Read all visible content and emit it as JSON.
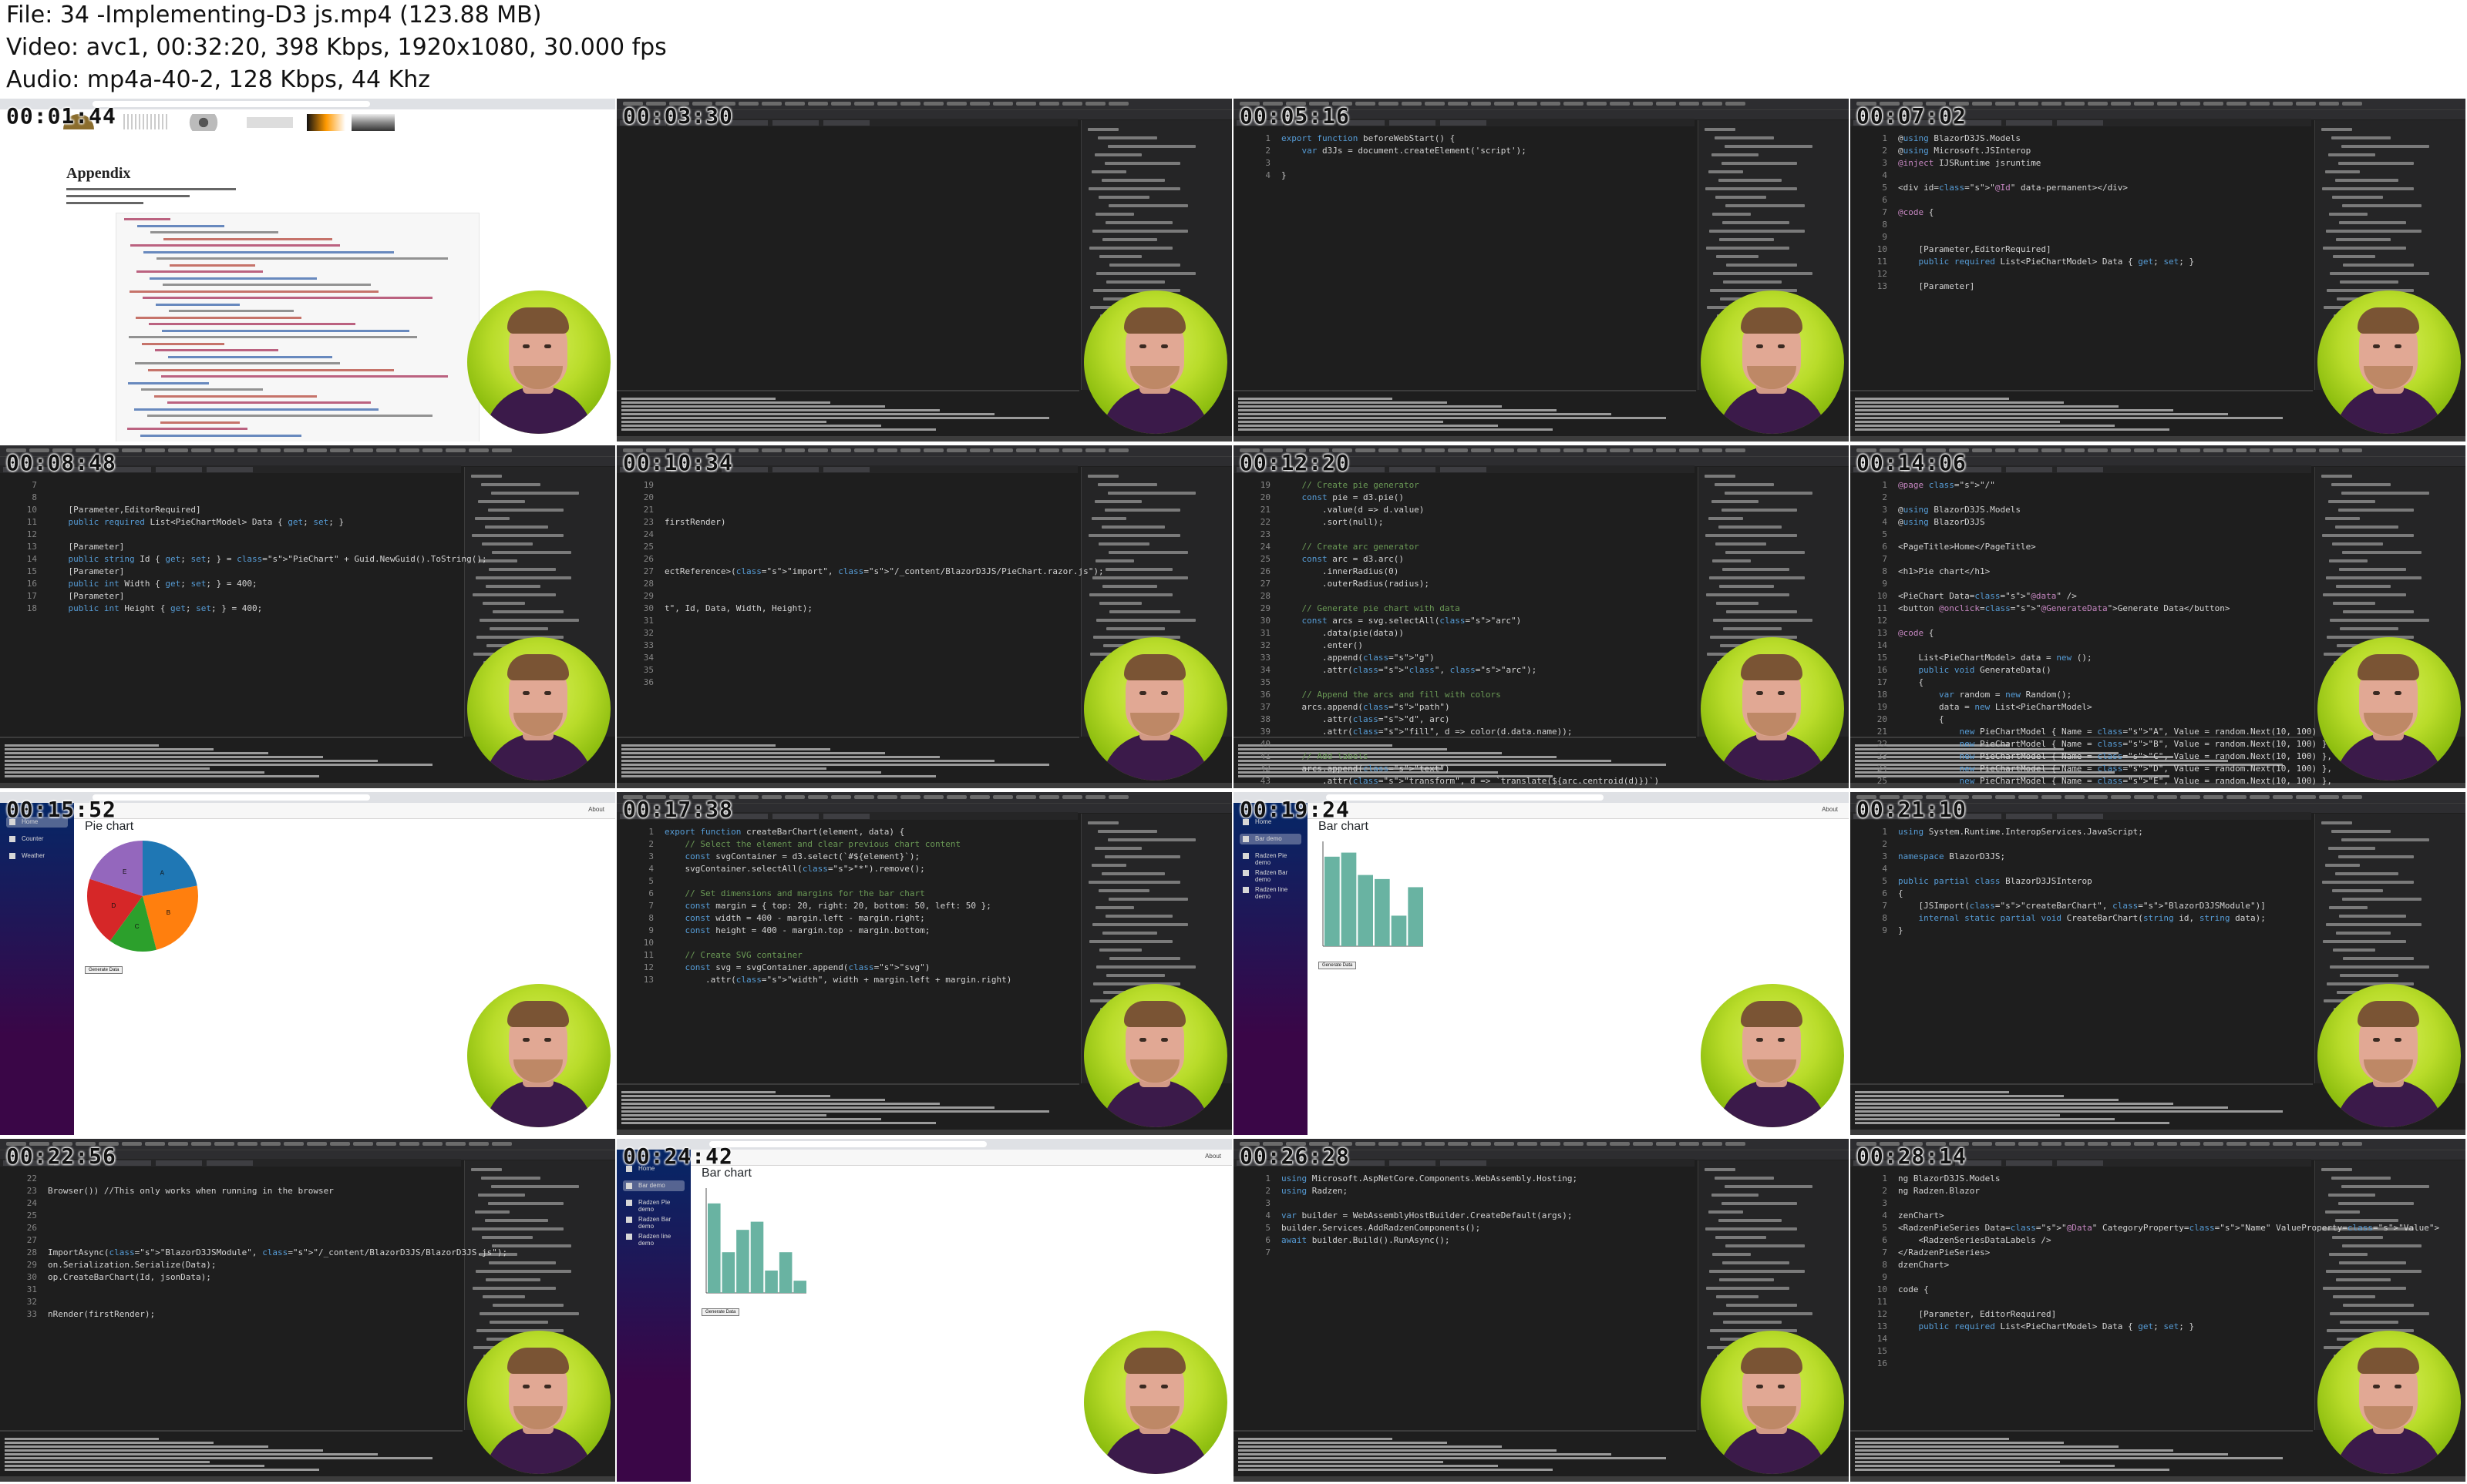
{
  "header": {
    "file_line": "File: 34 -Implementing-D3 js.mp4 (123.88 MB)",
    "video_line": "Video: avc1, 00:32:20, 398 Kbps, 1920x1080, 30.000 fps",
    "audio_line": "Audio: mp4a-40-2, 128 Kbps, 44 Khz"
  },
  "thumbnails": [
    {
      "time": "00:01:44",
      "kind": "web-doc",
      "title": "Appendix"
    },
    {
      "time": "00:03:30",
      "kind": "ide-empty"
    },
    {
      "time": "00:05:16",
      "kind": "ide-code",
      "lines": [
        {
          "n": "1",
          "text": "export function beforeWebStart() {"
        },
        {
          "n": "2",
          "text": "    var d3Js = document.createElement('script');"
        },
        {
          "n": "3",
          "text": ""
        },
        {
          "n": "4",
          "text": "}"
        }
      ]
    },
    {
      "time": "00:07:02",
      "kind": "ide-code",
      "lines": [
        {
          "n": "1",
          "text": "@using BlazorD3JS.Models"
        },
        {
          "n": "2",
          "text": "@using Microsoft.JSInterop"
        },
        {
          "n": "3",
          "text": "@inject IJSRuntime jsruntime"
        },
        {
          "n": "4",
          "text": ""
        },
        {
          "n": "5",
          "text": "<div id=\"@Id\" data-permanent></div>"
        },
        {
          "n": "6",
          "text": ""
        },
        {
          "n": "7",
          "text": "@code {"
        },
        {
          "n": "8",
          "text": ""
        },
        {
          "n": "9",
          "text": ""
        },
        {
          "n": "10",
          "text": "    [Parameter,EditorRequired]"
        },
        {
          "n": "11",
          "text": "    public required List<PieChartModel> Data { get; set; }"
        },
        {
          "n": "12",
          "text": ""
        },
        {
          "n": "13",
          "text": "    [Parameter]"
        }
      ]
    },
    {
      "time": "00:08:48",
      "kind": "ide-code",
      "lines": [
        {
          "n": "7",
          "text": ""
        },
        {
          "n": "8",
          "text": ""
        },
        {
          "n": "10",
          "text": "    [Parameter,EditorRequired]"
        },
        {
          "n": "11",
          "text": "    public required List<PieChartModel> Data { get; set; }"
        },
        {
          "n": "12",
          "text": ""
        },
        {
          "n": "13",
          "text": "    [Parameter]"
        },
        {
          "n": "14",
          "text": "    public string Id { get; set; } = \"PieChart\" + Guid.NewGuid().ToString();"
        },
        {
          "n": "15",
          "text": "    [Parameter]"
        },
        {
          "n": "16",
          "text": "    public int Width { get; set; } = 400;"
        },
        {
          "n": "17",
          "text": "    [Parameter]"
        },
        {
          "n": "18",
          "text": "    public int Height { get; set; } = 400;"
        }
      ]
    },
    {
      "time": "00:10:34",
      "kind": "ide-code",
      "lines": [
        {
          "n": "19",
          "text": ""
        },
        {
          "n": "20",
          "text": ""
        },
        {
          "n": "21",
          "text": ""
        },
        {
          "n": "23",
          "text": "firstRender)"
        },
        {
          "n": "24",
          "text": ""
        },
        {
          "n": "25",
          "text": ""
        },
        {
          "n": "26",
          "text": ""
        },
        {
          "n": "27",
          "text": "ectReference>(\"import\", \"/_content/BlazorD3JS/PieChart.razor.js\");"
        },
        {
          "n": "28",
          "text": ""
        },
        {
          "n": "29",
          "text": ""
        },
        {
          "n": "30",
          "text": "t\", Id, Data, Width, Height);"
        },
        {
          "n": "31",
          "text": ""
        },
        {
          "n": "32",
          "text": ""
        },
        {
          "n": "33",
          "text": ""
        },
        {
          "n": "34",
          "text": ""
        },
        {
          "n": "35",
          "text": ""
        },
        {
          "n": "36",
          "text": ""
        }
      ]
    },
    {
      "time": "00:12:20",
      "kind": "ide-code",
      "lines": [
        {
          "n": "19",
          "text": "    // Create pie generator"
        },
        {
          "n": "20",
          "text": "    const pie = d3.pie()"
        },
        {
          "n": "21",
          "text": "        .value(d => d.value)"
        },
        {
          "n": "22",
          "text": "        .sort(null);"
        },
        {
          "n": "23",
          "text": ""
        },
        {
          "n": "24",
          "text": "    // Create arc generator"
        },
        {
          "n": "25",
          "text": "    const arc = d3.arc()"
        },
        {
          "n": "26",
          "text": "        .innerRadius(0)"
        },
        {
          "n": "27",
          "text": "        .outerRadius(radius);"
        },
        {
          "n": "28",
          "text": ""
        },
        {
          "n": "29",
          "text": "    // Generate pie chart with data"
        },
        {
          "n": "30",
          "text": "    const arcs = svg.selectAll(\"arc\")"
        },
        {
          "n": "31",
          "text": "        .data(pie(data))"
        },
        {
          "n": "32",
          "text": "        .enter()"
        },
        {
          "n": "33",
          "text": "        .append(\"g\")"
        },
        {
          "n": "34",
          "text": "        .attr(\"class\", \"arc\");"
        },
        {
          "n": "35",
          "text": ""
        },
        {
          "n": "36",
          "text": "    // Append the arcs and fill with colors"
        },
        {
          "n": "37",
          "text": "    arcs.append(\"path\")"
        },
        {
          "n": "38",
          "text": "        .attr(\"d\", arc)"
        },
        {
          "n": "39",
          "text": "        .attr(\"fill\", d => color(d.data.name));"
        },
        {
          "n": "40",
          "text": ""
        },
        {
          "n": "41",
          "text": "    // Add labels"
        },
        {
          "n": "42",
          "text": "    arcs.append(\"text\")"
        },
        {
          "n": "43",
          "text": "        .attr(\"transform\", d => `translate(${arc.centroid(d)})`)"
        }
      ]
    },
    {
      "time": "00:14:06",
      "kind": "ide-code",
      "lines": [
        {
          "n": "1",
          "text": "@page \"/\""
        },
        {
          "n": "2",
          "text": ""
        },
        {
          "n": "3",
          "text": "@using BlazorD3JS.Models"
        },
        {
          "n": "4",
          "text": "@using BlazorD3JS"
        },
        {
          "n": "5",
          "text": ""
        },
        {
          "n": "6",
          "text": "<PageTitle>Home</PageTitle>"
        },
        {
          "n": "7",
          "text": ""
        },
        {
          "n": "8",
          "text": "<h1>Pie chart</h1>"
        },
        {
          "n": "9",
          "text": ""
        },
        {
          "n": "10",
          "text": "<PieChart Data=\"@data\" />"
        },
        {
          "n": "11",
          "text": "<button @onclick=\"@GenerateData\">Generate Data</button>"
        },
        {
          "n": "12",
          "text": ""
        },
        {
          "n": "13",
          "text": "@code {"
        },
        {
          "n": "14",
          "text": ""
        },
        {
          "n": "15",
          "text": "    List<PieChartModel> data = new ();"
        },
        {
          "n": "16",
          "text": "    public void GenerateData()"
        },
        {
          "n": "17",
          "text": "    {"
        },
        {
          "n": "18",
          "text": "        var random = new Random();"
        },
        {
          "n": "19",
          "text": "        data = new List<PieChartModel>"
        },
        {
          "n": "20",
          "text": "        {"
        },
        {
          "n": "21",
          "text": "            new PieChartModel { Name = \"A\", Value = random.Next(10, 100) },"
        },
        {
          "n": "22",
          "text": "            new PieChartModel { Name = \"B\", Value = random.Next(10, 100) },"
        },
        {
          "n": "23",
          "text": "            new PieChartModel { Name = \"C\", Value = random.Next(10, 100) },"
        },
        {
          "n": "24",
          "text": "            new PieChartModel { Name = \"D\", Value = random.Next(10, 100) },"
        },
        {
          "n": "25",
          "text": "            new PieChartModel { Name = \"E\", Value = random.Next(10, 100) },"
        }
      ]
    },
    {
      "time": "00:15:52",
      "kind": "app-pie",
      "title": "Pie chart",
      "button": "Generate Data",
      "nav": [
        "Home",
        "Counter",
        "Weather"
      ],
      "slices": [
        {
          "name": "A",
          "value": 22,
          "color": "#1f77b4"
        },
        {
          "name": "B",
          "value": 24,
          "color": "#ff7f0e"
        },
        {
          "name": "C",
          "value": 14,
          "color": "#2ca02c"
        },
        {
          "name": "D",
          "value": 20,
          "color": "#d62728"
        },
        {
          "name": "E",
          "value": 20,
          "color": "#9467bd"
        }
      ]
    },
    {
      "time": "00:17:38",
      "kind": "ide-code",
      "lines": [
        {
          "n": "1",
          "text": "export function createBarChart(element, data) {"
        },
        {
          "n": "2",
          "text": "    // Select the element and clear previous chart content"
        },
        {
          "n": "3",
          "text": "    const svgContainer = d3.select(`#${element}`);"
        },
        {
          "n": "4",
          "text": "    svgContainer.selectAll(\"*\").remove();"
        },
        {
          "n": "5",
          "text": ""
        },
        {
          "n": "6",
          "text": "    // Set dimensions and margins for the bar chart"
        },
        {
          "n": "7",
          "text": "    const margin = { top: 20, right: 20, bottom: 50, left: 50 };"
        },
        {
          "n": "8",
          "text": "    const width = 400 - margin.left - margin.right;"
        },
        {
          "n": "9",
          "text": "    const height = 400 - margin.top - margin.bottom;"
        },
        {
          "n": "10",
          "text": ""
        },
        {
          "n": "11",
          "text": "    // Create SVG container"
        },
        {
          "n": "12",
          "text": "    const svg = svgContainer.append(\"svg\")"
        },
        {
          "n": "13",
          "text": "        .attr(\"width\", width + margin.left + margin.right)"
        }
      ]
    },
    {
      "time": "00:19:24",
      "kind": "app-bar",
      "title": "Bar chart",
      "button": "Generate Data",
      "nav": [
        "Home",
        "Bar demo",
        "Radzen Pie demo",
        "Radzen Bar demo",
        "Radzen line demo"
      ],
      "bars": [
        88,
        92,
        70,
        66,
        30,
        58
      ]
    },
    {
      "time": "00:21:10",
      "kind": "ide-code",
      "lines": [
        {
          "n": "1",
          "text": "using System.Runtime.InteropServices.JavaScript;"
        },
        {
          "n": "2",
          "text": ""
        },
        {
          "n": "3",
          "text": "namespace BlazorD3JS;"
        },
        {
          "n": "4",
          "text": ""
        },
        {
          "n": "5",
          "text": "public partial class BlazorD3JSInterop"
        },
        {
          "n": "6",
          "text": "{"
        },
        {
          "n": "7",
          "text": "    [JSImport(\"createBarChart\", \"BlazorD3JSModule\")]"
        },
        {
          "n": "8",
          "text": "    internal static partial void CreateBarChart(string id, string data);"
        },
        {
          "n": "9",
          "text": "}"
        }
      ]
    },
    {
      "time": "00:22:56",
      "kind": "ide-code",
      "lines": [
        {
          "n": "22",
          "text": ""
        },
        {
          "n": "23",
          "text": "Browser()) //This only works when running in the browser"
        },
        {
          "n": "24",
          "text": ""
        },
        {
          "n": "25",
          "text": ""
        },
        {
          "n": "26",
          "text": ""
        },
        {
          "n": "27",
          "text": ""
        },
        {
          "n": "28",
          "text": "ImportAsync(\"BlazorD3JSModule\", \"/_content/BlazorD3JS/BlazorD3JS.js\");"
        },
        {
          "n": "29",
          "text": "on.Serialization.Serialize(Data);"
        },
        {
          "n": "30",
          "text": "op.CreateBarChart(Id, jsonData);"
        },
        {
          "n": "31",
          "text": ""
        },
        {
          "n": "32",
          "text": ""
        },
        {
          "n": "33",
          "text": "nRender(firstRender);"
        }
      ]
    },
    {
      "time": "00:24:42",
      "kind": "app-bar",
      "title": "Bar chart",
      "button": "Generate Data",
      "nav": [
        "Home",
        "Bar demo",
        "Radzen Pie demo",
        "Radzen Bar demo",
        "Radzen line demo"
      ],
      "bars": [
        88,
        40,
        62,
        70,
        22,
        40,
        12
      ]
    },
    {
      "time": "00:26:28",
      "kind": "ide-code",
      "lines": [
        {
          "n": "1",
          "text": "using Microsoft.AspNetCore.Components.WebAssembly.Hosting;"
        },
        {
          "n": "2",
          "text": "using Radzen;"
        },
        {
          "n": "3",
          "text": ""
        },
        {
          "n": "4",
          "text": "var builder = WebAssemblyHostBuilder.CreateDefault(args);"
        },
        {
          "n": "5",
          "text": "builder.Services.AddRadzenComponents();"
        },
        {
          "n": "6",
          "text": "await builder.Build().RunAsync();"
        },
        {
          "n": "7",
          "text": ""
        }
      ]
    },
    {
      "time": "00:28:14",
      "kind": "ide-code",
      "lines": [
        {
          "n": "1",
          "text": "ng BlazorD3JS.Models"
        },
        {
          "n": "2",
          "text": "ng Radzen.Blazor"
        },
        {
          "n": "3",
          "text": ""
        },
        {
          "n": "4",
          "text": "zenChart>"
        },
        {
          "n": "5",
          "text": "<RadzenPieSeries Data=\"@Data\" CategoryProperty=\"Name\" ValueProperty=\"Value\">"
        },
        {
          "n": "6",
          "text": "    <RadzenSeriesDataLabels />"
        },
        {
          "n": "7",
          "text": "</RadzenPieSeries>"
        },
        {
          "n": "8",
          "text": "dzenChart>"
        },
        {
          "n": "9",
          "text": ""
        },
        {
          "n": "10",
          "text": "code {"
        },
        {
          "n": "11",
          "text": ""
        },
        {
          "n": "12",
          "text": "    [Parameter, EditorRequired]"
        },
        {
          "n": "13",
          "text": "    public required List<PieChartModel> Data { get; set; }"
        },
        {
          "n": "14",
          "text": ""
        },
        {
          "n": "15",
          "text": ""
        },
        {
          "n": "16",
          "text": ""
        }
      ]
    }
  ]
}
